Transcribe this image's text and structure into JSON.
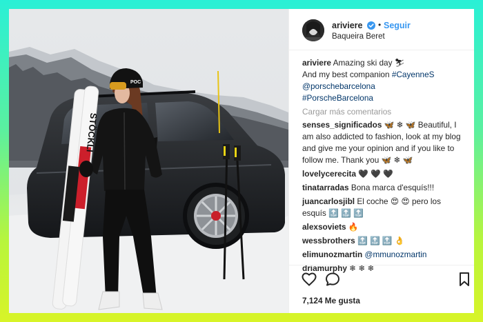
{
  "post": {
    "username": "ariviere",
    "follow_label": "Seguir",
    "location": "Baqueira Beret",
    "separator": "•"
  },
  "caption": {
    "username": "ariviere",
    "line1": " Amazing ski day ⛷",
    "line2": "And my best companion ",
    "hashtag1": "#CayenneS",
    "mention1": "@porschebarcelona",
    "hashtag2": "#PorscheBarcelona"
  },
  "load_more_label": "Cargar más comentarios",
  "comments": [
    {
      "user": "senses_significados",
      "text": " 🦋 ❄ 🦋 Beautiful, I am also addicted to fashion, look at my blog and give me your opinion and if you like to follow me. Thank you 🦋 ❄ 🦋"
    },
    {
      "user": "lovelycerecita",
      "text": " 🖤 🖤 🖤"
    },
    {
      "user": "tinatarradas",
      "text": " Bona marca d'esquís!!!"
    },
    {
      "user": "juancarlosjibl",
      "text": " El coche 😍 😍 pero los esquís 🔝 🔝 🔝"
    },
    {
      "user": "alexsoviets",
      "text": " 🔥"
    },
    {
      "user": "wessbrothers",
      "text": " 🔝 🔝 🔝 👌"
    },
    {
      "user": "elimunozmartin",
      "mention": " @mmunozmartin",
      "text": ""
    },
    {
      "user": "driamurphy",
      "text": " ❄ ❄ ❄"
    }
  ],
  "likes_label": "7,124 Me gusta",
  "icons": [
    "heart-icon",
    "comment-icon",
    "bookmark-icon",
    "verified-badge-icon"
  ],
  "colors": {
    "link": "#3897f0",
    "hashtag": "#003569",
    "muted": "#999999",
    "text": "#262626"
  },
  "photo": {
    "ski_brand": "STÖCKLI",
    "helmet_brand": "POC"
  }
}
